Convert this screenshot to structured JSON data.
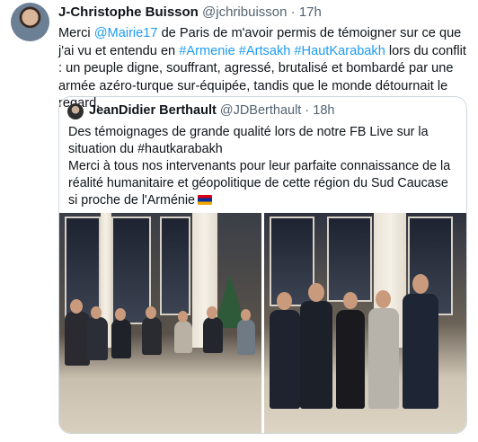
{
  "tweet": {
    "author_name": "J-Christophe Buisson",
    "author_handle": "@jchribuisson",
    "separator": "·",
    "time": "17h",
    "text_parts": {
      "p1": "Merci ",
      "mention": "@Mairie17",
      "p2": " de Paris de m'avoir permis de témoigner sur ce que j'ai vu et entendu en ",
      "hashtag1": "#Armenie",
      "space1": " ",
      "hashtag2": "#Artsakh",
      "space2": " ",
      "hashtag3": "#HautKarabakh",
      "p3": " lors du conflit : un peuple digne, souffrant, agressé, brutalisé et bombardé par une armée azéro-turque sur-équipée, tandis que le monde détournait le regard."
    }
  },
  "quoted": {
    "author_name": "JeanDidier Berthault",
    "author_handle": "@JDBerthault",
    "separator": "·",
    "time": "18h",
    "line1": "Des témoignages de grande qualité lors de notre FB Live sur la situation du #hautkarabakh",
    "line2": "Merci à tous nos intervenants pour leur parfaite connaissance de la réalité humanitaire et géopolitique de cette région du Sud Caucase si proche de l'Arménie",
    "flag_icon": "armenian-flag"
  }
}
